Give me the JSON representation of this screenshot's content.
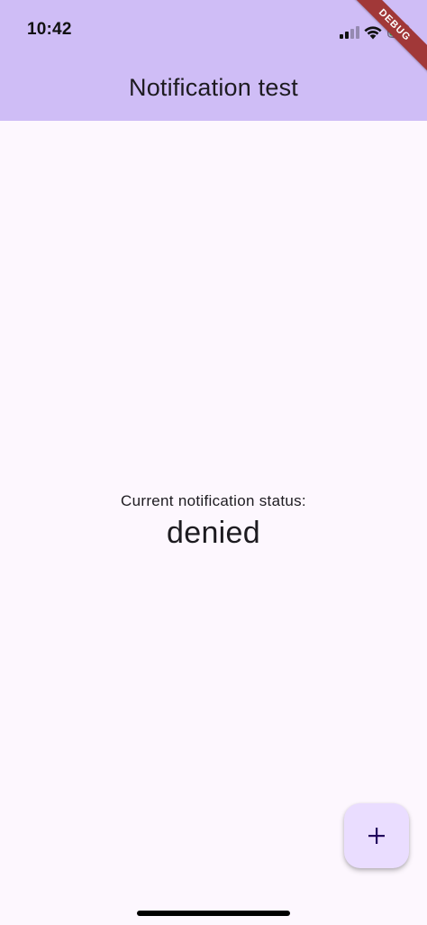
{
  "status_bar": {
    "time": "10:42",
    "signal_icon": "signal-icon",
    "wifi_icon": "wifi-icon",
    "battery_icon": "battery-charging-icon",
    "signal_bars_active": 2,
    "signal_bars_total": 4
  },
  "app_bar": {
    "title": "Notification test",
    "background_color": "#CFBDF6"
  },
  "debug_banner": {
    "label": "DEBUG",
    "color": "#A13838"
  },
  "main": {
    "status_label": "Current notification status:",
    "status_value": "denied"
  },
  "fab": {
    "icon": "add-icon",
    "background_color": "#EADDFF"
  },
  "colors": {
    "page_background": "#FDF7FE",
    "text": "#1D1B20"
  }
}
